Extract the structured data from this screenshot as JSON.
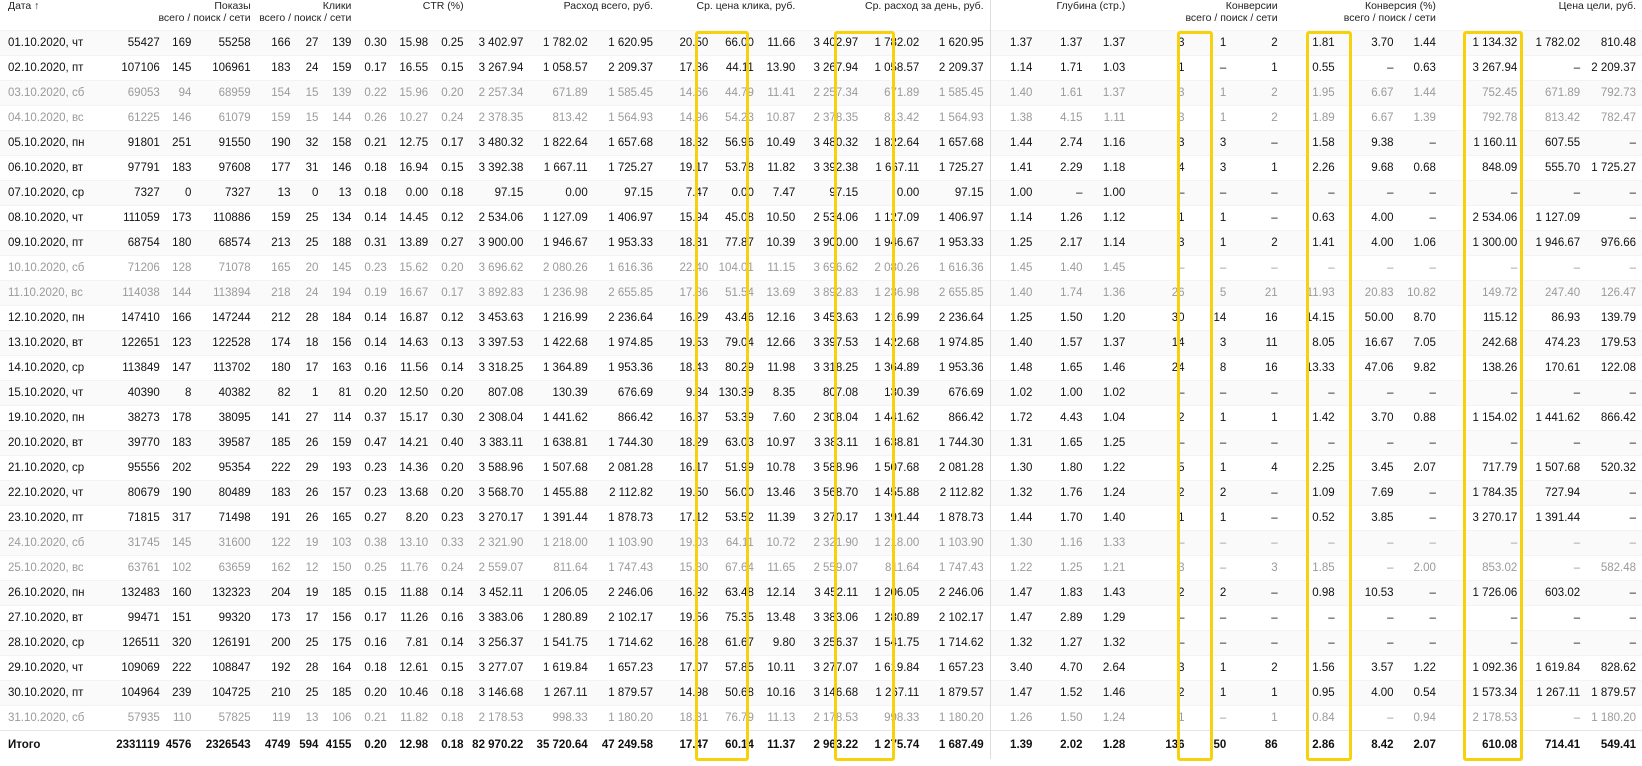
{
  "headers": {
    "date": "Дата ↑",
    "shows": {
      "title": "Показы",
      "sub": "всего / поиск / сети"
    },
    "clicks": {
      "title": "Клики",
      "sub": "всего / поиск / сети"
    },
    "ctr": {
      "title": "CTR (%)",
      "sub": ""
    },
    "cost": {
      "title": "Расход всего, руб.",
      "sub": ""
    },
    "cpc": {
      "title": "Ср. цена клика, руб.",
      "sub": ""
    },
    "daily": {
      "title": "Ср. расход за день, руб.",
      "sub": ""
    },
    "depth": {
      "title": "Глубина (стр.)",
      "sub": ""
    },
    "conv": {
      "title": "Конверсии",
      "sub": "всего / поиск / сети"
    },
    "convrate": {
      "title": "Конверсия (%)",
      "sub": "всего / поиск / сети"
    },
    "goal": {
      "title": "Цена цели, руб.",
      "sub": ""
    }
  },
  "rows": [
    {
      "weekend": false,
      "cells": [
        "01.10.2020, чт",
        "55427",
        "169",
        "55258",
        "166",
        "27",
        "139",
        "0.30",
        "15.98",
        "0.25",
        "3 402.97",
        "1 782.02",
        "1 620.95",
        "20.50",
        "66.00",
        "11.66",
        "3 402.97",
        "1 782.02",
        "1 620.95",
        "1.37",
        "1.37",
        "1.37",
        "3",
        "1",
        "2",
        "1.81",
        "3.70",
        "1.44",
        "1 134.32",
        "1 782.02",
        "810.48"
      ]
    },
    {
      "weekend": false,
      "cells": [
        "02.10.2020, пт",
        "107106",
        "145",
        "106961",
        "183",
        "24",
        "159",
        "0.17",
        "16.55",
        "0.15",
        "3 267.94",
        "1 058.57",
        "2 209.37",
        "17.86",
        "44.11",
        "13.90",
        "3 267.94",
        "1 058.57",
        "2 209.37",
        "1.14",
        "1.71",
        "1.03",
        "1",
        "–",
        "1",
        "0.55",
        "–",
        "0.63",
        "3 267.94",
        "–",
        "2 209.37"
      ]
    },
    {
      "weekend": true,
      "cells": [
        "03.10.2020, сб",
        "69053",
        "94",
        "68959",
        "154",
        "15",
        "139",
        "0.22",
        "15.96",
        "0.20",
        "2 257.34",
        "671.89",
        "1 585.45",
        "14.66",
        "44.79",
        "11.41",
        "2 257.34",
        "671.89",
        "1 585.45",
        "1.40",
        "1.61",
        "1.37",
        "3",
        "1",
        "2",
        "1.95",
        "6.67",
        "1.44",
        "752.45",
        "671.89",
        "792.73"
      ]
    },
    {
      "weekend": true,
      "cells": [
        "04.10.2020, вс",
        "61225",
        "146",
        "61079",
        "159",
        "15",
        "144",
        "0.26",
        "10.27",
        "0.24",
        "2 378.35",
        "813.42",
        "1 564.93",
        "14.96",
        "54.23",
        "10.87",
        "2 378.35",
        "813.42",
        "1 564.93",
        "1.38",
        "4.15",
        "1.11",
        "3",
        "1",
        "2",
        "1.89",
        "6.67",
        "1.39",
        "792.78",
        "813.42",
        "782.47"
      ]
    },
    {
      "weekend": false,
      "cells": [
        "05.10.2020, пн",
        "91801",
        "251",
        "91550",
        "190",
        "32",
        "158",
        "0.21",
        "12.75",
        "0.17",
        "3 480.32",
        "1 822.64",
        "1 657.68",
        "18.32",
        "56.96",
        "10.49",
        "3 480.32",
        "1 822.64",
        "1 657.68",
        "1.44",
        "2.74",
        "1.16",
        "3",
        "3",
        "–",
        "1.58",
        "9.38",
        "–",
        "1 160.11",
        "607.55",
        "–"
      ]
    },
    {
      "weekend": false,
      "cells": [
        "06.10.2020, вт",
        "97791",
        "183",
        "97608",
        "177",
        "31",
        "146",
        "0.18",
        "16.94",
        "0.15",
        "3 392.38",
        "1 667.11",
        "1 725.27",
        "19.17",
        "53.78",
        "11.82",
        "3 392.38",
        "1 667.11",
        "1 725.27",
        "1.41",
        "2.29",
        "1.18",
        "4",
        "3",
        "1",
        "2.26",
        "9.68",
        "0.68",
        "848.09",
        "555.70",
        "1 725.27"
      ]
    },
    {
      "weekend": false,
      "cells": [
        "07.10.2020, ср",
        "7327",
        "0",
        "7327",
        "13",
        "0",
        "13",
        "0.18",
        "0.00",
        "0.18",
        "97.15",
        "0.00",
        "97.15",
        "7.47",
        "0.00",
        "7.47",
        "97.15",
        "0.00",
        "97.15",
        "1.00",
        "–",
        "1.00",
        "–",
        "–",
        "–",
        "–",
        "–",
        "–",
        "–",
        "–",
        "–"
      ]
    },
    {
      "weekend": false,
      "cells": [
        "08.10.2020, чт",
        "111059",
        "173",
        "110886",
        "159",
        "25",
        "134",
        "0.14",
        "14.45",
        "0.12",
        "2 534.06",
        "1 127.09",
        "1 406.97",
        "15.94",
        "45.08",
        "10.50",
        "2 534.06",
        "1 127.09",
        "1 406.97",
        "1.14",
        "1.26",
        "1.12",
        "1",
        "1",
        "–",
        "0.63",
        "4.00",
        "–",
        "2 534.06",
        "1 127.09",
        "–"
      ]
    },
    {
      "weekend": false,
      "cells": [
        "09.10.2020, пт",
        "68754",
        "180",
        "68574",
        "213",
        "25",
        "188",
        "0.31",
        "13.89",
        "0.27",
        "3 900.00",
        "1 946.67",
        "1 953.33",
        "18.31",
        "77.87",
        "10.39",
        "3 900.00",
        "1 946.67",
        "1 953.33",
        "1.25",
        "2.17",
        "1.14",
        "3",
        "1",
        "2",
        "1.41",
        "4.00",
        "1.06",
        "1 300.00",
        "1 946.67",
        "976.66"
      ]
    },
    {
      "weekend": true,
      "cells": [
        "10.10.2020, сб",
        "71206",
        "128",
        "71078",
        "165",
        "20",
        "145",
        "0.23",
        "15.62",
        "0.20",
        "3 696.62",
        "2 080.26",
        "1 616.36",
        "22.40",
        "104.01",
        "11.15",
        "3 696.62",
        "2 080.26",
        "1 616.36",
        "1.45",
        "1.40",
        "1.45",
        "–",
        "–",
        "–",
        "–",
        "–",
        "–",
        "–",
        "–",
        "–"
      ]
    },
    {
      "weekend": true,
      "cells": [
        "11.10.2020, вс",
        "114038",
        "144",
        "113894",
        "218",
        "24",
        "194",
        "0.19",
        "16.67",
        "0.17",
        "3 892.83",
        "1 236.98",
        "2 655.85",
        "17.86",
        "51.54",
        "13.69",
        "3 892.83",
        "1 236.98",
        "2 655.85",
        "1.40",
        "1.74",
        "1.36",
        "26",
        "5",
        "21",
        "11.93",
        "20.83",
        "10.82",
        "149.72",
        "247.40",
        "126.47"
      ]
    },
    {
      "weekend": false,
      "cells": [
        "12.10.2020, пн",
        "147410",
        "166",
        "147244",
        "212",
        "28",
        "184",
        "0.14",
        "16.87",
        "0.12",
        "3 453.63",
        "1 216.99",
        "2 236.64",
        "16.29",
        "43.46",
        "12.16",
        "3 453.63",
        "1 216.99",
        "2 236.64",
        "1.25",
        "1.50",
        "1.20",
        "30",
        "14",
        "16",
        "14.15",
        "50.00",
        "8.70",
        "115.12",
        "86.93",
        "139.79"
      ]
    },
    {
      "weekend": false,
      "cells": [
        "13.10.2020, вт",
        "122651",
        "123",
        "122528",
        "174",
        "18",
        "156",
        "0.14",
        "14.63",
        "0.13",
        "3 397.53",
        "1 422.68",
        "1 974.85",
        "19.53",
        "79.04",
        "12.66",
        "3 397.53",
        "1 422.68",
        "1 974.85",
        "1.40",
        "1.57",
        "1.37",
        "14",
        "3",
        "11",
        "8.05",
        "16.67",
        "7.05",
        "242.68",
        "474.23",
        "179.53"
      ]
    },
    {
      "weekend": false,
      "cells": [
        "14.10.2020, ср",
        "113849",
        "147",
        "113702",
        "180",
        "17",
        "163",
        "0.16",
        "11.56",
        "0.14",
        "3 318.25",
        "1 364.89",
        "1 953.36",
        "18.43",
        "80.29",
        "11.98",
        "3 318.25",
        "1 364.89",
        "1 953.36",
        "1.48",
        "1.65",
        "1.46",
        "24",
        "8",
        "16",
        "13.33",
        "47.06",
        "9.82",
        "138.26",
        "170.61",
        "122.08"
      ]
    },
    {
      "weekend": false,
      "cells": [
        "15.10.2020, чт",
        "40390",
        "8",
        "40382",
        "82",
        "1",
        "81",
        "0.20",
        "12.50",
        "0.20",
        "807.08",
        "130.39",
        "676.69",
        "9.84",
        "130.39",
        "8.35",
        "807.08",
        "130.39",
        "676.69",
        "1.02",
        "1.00",
        "1.02",
        "–",
        "–",
        "–",
        "–",
        "–",
        "–",
        "–",
        "–",
        "–"
      ]
    },
    {
      "weekend": false,
      "cells": [
        "19.10.2020, пн",
        "38273",
        "178",
        "38095",
        "141",
        "27",
        "114",
        "0.37",
        "15.17",
        "0.30",
        "2 308.04",
        "1 441.62",
        "866.42",
        "16.37",
        "53.39",
        "7.60",
        "2 308.04",
        "1 441.62",
        "866.42",
        "1.72",
        "4.43",
        "1.04",
        "2",
        "1",
        "1",
        "1.42",
        "3.70",
        "0.88",
        "1 154.02",
        "1 441.62",
        "866.42"
      ]
    },
    {
      "weekend": false,
      "cells": [
        "20.10.2020, вт",
        "39770",
        "183",
        "39587",
        "185",
        "26",
        "159",
        "0.47",
        "14.21",
        "0.40",
        "3 383.11",
        "1 638.81",
        "1 744.30",
        "18.29",
        "63.03",
        "10.97",
        "3 383.11",
        "1 638.81",
        "1 744.30",
        "1.31",
        "1.65",
        "1.25",
        "–",
        "–",
        "–",
        "–",
        "–",
        "–",
        "–",
        "–",
        "–"
      ]
    },
    {
      "weekend": false,
      "cells": [
        "21.10.2020, ср",
        "95556",
        "202",
        "95354",
        "222",
        "29",
        "193",
        "0.23",
        "14.36",
        "0.20",
        "3 588.96",
        "1 507.68",
        "2 081.28",
        "16.17",
        "51.99",
        "10.78",
        "3 588.96",
        "1 507.68",
        "2 081.28",
        "1.30",
        "1.80",
        "1.22",
        "5",
        "1",
        "4",
        "2.25",
        "3.45",
        "2.07",
        "717.79",
        "1 507.68",
        "520.32"
      ]
    },
    {
      "weekend": false,
      "cells": [
        "22.10.2020, чт",
        "80679",
        "190",
        "80489",
        "183",
        "26",
        "157",
        "0.23",
        "13.68",
        "0.20",
        "3 568.70",
        "1 455.88",
        "2 112.82",
        "19.50",
        "56.00",
        "13.46",
        "3 568.70",
        "1 455.88",
        "2 112.82",
        "1.32",
        "1.76",
        "1.24",
        "2",
        "2",
        "–",
        "1.09",
        "7.69",
        "–",
        "1 784.35",
        "727.94",
        "–"
      ]
    },
    {
      "weekend": false,
      "cells": [
        "23.10.2020, пт",
        "71815",
        "317",
        "71498",
        "191",
        "26",
        "165",
        "0.27",
        "8.20",
        "0.23",
        "3 270.17",
        "1 391.44",
        "1 878.73",
        "17.12",
        "53.52",
        "11.39",
        "3 270.17",
        "1 391.44",
        "1 878.73",
        "1.44",
        "1.70",
        "1.40",
        "1",
        "1",
        "–",
        "0.52",
        "3.85",
        "–",
        "3 270.17",
        "1 391.44",
        "–"
      ]
    },
    {
      "weekend": true,
      "cells": [
        "24.10.2020, сб",
        "31745",
        "145",
        "31600",
        "122",
        "19",
        "103",
        "0.38",
        "13.10",
        "0.33",
        "2 321.90",
        "1 218.00",
        "1 103.90",
        "19.03",
        "64.11",
        "10.72",
        "2 321.90",
        "1 218.00",
        "1 103.90",
        "1.30",
        "1.16",
        "1.33",
        "–",
        "–",
        "–",
        "–",
        "–",
        "–",
        "–",
        "–",
        "–"
      ]
    },
    {
      "weekend": true,
      "cells": [
        "25.10.2020, вс",
        "63761",
        "102",
        "63659",
        "162",
        "12",
        "150",
        "0.25",
        "11.76",
        "0.24",
        "2 559.07",
        "811.64",
        "1 747.43",
        "15.80",
        "67.64",
        "11.65",
        "2 559.07",
        "811.64",
        "1 747.43",
        "1.22",
        "1.25",
        "1.21",
        "3",
        "–",
        "3",
        "1.85",
        "–",
        "2.00",
        "853.02",
        "–",
        "582.48"
      ]
    },
    {
      "weekend": false,
      "cells": [
        "26.10.2020, пн",
        "132483",
        "160",
        "132323",
        "204",
        "19",
        "185",
        "0.15",
        "11.88",
        "0.14",
        "3 452.11",
        "1 206.05",
        "2 246.06",
        "16.92",
        "63.48",
        "12.14",
        "3 452.11",
        "1 206.05",
        "2 246.06",
        "1.47",
        "1.83",
        "1.43",
        "2",
        "2",
        "–",
        "0.98",
        "10.53",
        "–",
        "1 726.06",
        "603.02",
        "–"
      ]
    },
    {
      "weekend": false,
      "cells": [
        "27.10.2020, вт",
        "99471",
        "151",
        "99320",
        "173",
        "17",
        "156",
        "0.17",
        "11.26",
        "0.16",
        "3 383.06",
        "1 280.89",
        "2 102.17",
        "19.56",
        "75.35",
        "13.48",
        "3 383.06",
        "1 280.89",
        "2 102.17",
        "1.47",
        "2.89",
        "1.29",
        "–",
        "–",
        "–",
        "–",
        "–",
        "–",
        "–",
        "–",
        "–"
      ]
    },
    {
      "weekend": false,
      "cells": [
        "28.10.2020, ср",
        "126511",
        "320",
        "126191",
        "200",
        "25",
        "175",
        "0.16",
        "7.81",
        "0.14",
        "3 256.37",
        "1 541.75",
        "1 714.62",
        "16.28",
        "61.67",
        "9.80",
        "3 256.37",
        "1 541.75",
        "1 714.62",
        "1.32",
        "1.27",
        "1.32",
        "–",
        "–",
        "–",
        "–",
        "–",
        "–",
        "–",
        "–",
        "–"
      ]
    },
    {
      "weekend": false,
      "cells": [
        "29.10.2020, чт",
        "109069",
        "222",
        "108847",
        "192",
        "28",
        "164",
        "0.18",
        "12.61",
        "0.15",
        "3 277.07",
        "1 619.84",
        "1 657.23",
        "17.07",
        "57.85",
        "10.11",
        "3 277.07",
        "1 619.84",
        "1 657.23",
        "3.40",
        "4.70",
        "2.64",
        "3",
        "1",
        "2",
        "1.56",
        "3.57",
        "1.22",
        "1 092.36",
        "1 619.84",
        "828.62"
      ]
    },
    {
      "weekend": false,
      "cells": [
        "30.10.2020, пт",
        "104964",
        "239",
        "104725",
        "210",
        "25",
        "185",
        "0.20",
        "10.46",
        "0.18",
        "3 146.68",
        "1 267.11",
        "1 879.57",
        "14.98",
        "50.68",
        "10.16",
        "3 146.68",
        "1 267.11",
        "1 879.57",
        "1.47",
        "1.52",
        "1.46",
        "2",
        "1",
        "1",
        "0.95",
        "4.00",
        "0.54",
        "1 573.34",
        "1 267.11",
        "1 879.57"
      ]
    },
    {
      "weekend": true,
      "cells": [
        "31.10.2020, сб",
        "57935",
        "110",
        "57825",
        "119",
        "13",
        "106",
        "0.21",
        "11.82",
        "0.18",
        "2 178.53",
        "998.33",
        "1 180.20",
        "18.31",
        "76.79",
        "11.13",
        "2 178.53",
        "998.33",
        "1 180.20",
        "1.26",
        "1.50",
        "1.24",
        "1",
        "–",
        "1",
        "0.84",
        "–",
        "0.94",
        "2 178.53",
        "–",
        "1 180.20"
      ]
    }
  ],
  "total": [
    "Итого",
    "2331119",
    "4576",
    "2326543",
    "4749",
    "594",
    "4155",
    "0.20",
    "12.98",
    "0.18",
    "82 970.22",
    "35 720.64",
    "47 249.58",
    "17.47",
    "60.14",
    "11.37",
    "2 963.22",
    "1 275.74",
    "1 687.49",
    "1.39",
    "2.02",
    "1.28",
    "136",
    "50",
    "86",
    "2.86",
    "8.42",
    "2.07",
    "610.08",
    "714.41",
    "549.41"
  ],
  "highlight_color": "#f5d20b",
  "weekend_text_color": "#9a9a9a"
}
